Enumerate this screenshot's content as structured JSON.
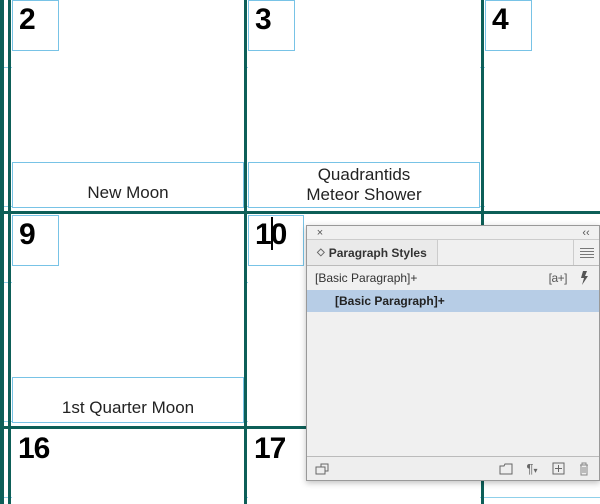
{
  "calendar": {
    "row1": {
      "c0": {
        "num": "2",
        "event": "New Moon"
      },
      "c1": {
        "num": "3",
        "event": "Quadrantids\nMeteor Shower"
      },
      "c2": {
        "num": "4"
      }
    },
    "row2": {
      "c0": {
        "num": "9",
        "event": "1st Quarter Moon"
      },
      "c1": {
        "num": "10"
      }
    },
    "row3": {
      "c0": {
        "num": "16"
      },
      "c1": {
        "num": "17"
      }
    }
  },
  "panel": {
    "title": "Paragraph Styles",
    "applied": "[Basic Paragraph]+",
    "override_indicator": "[a+]",
    "rows": {
      "0": "[Basic Paragraph]+"
    }
  },
  "icons": {
    "close": "×",
    "collapse": "‹‹",
    "sort": "◇",
    "quick": "𝑓",
    "pilcrow": "¶"
  }
}
